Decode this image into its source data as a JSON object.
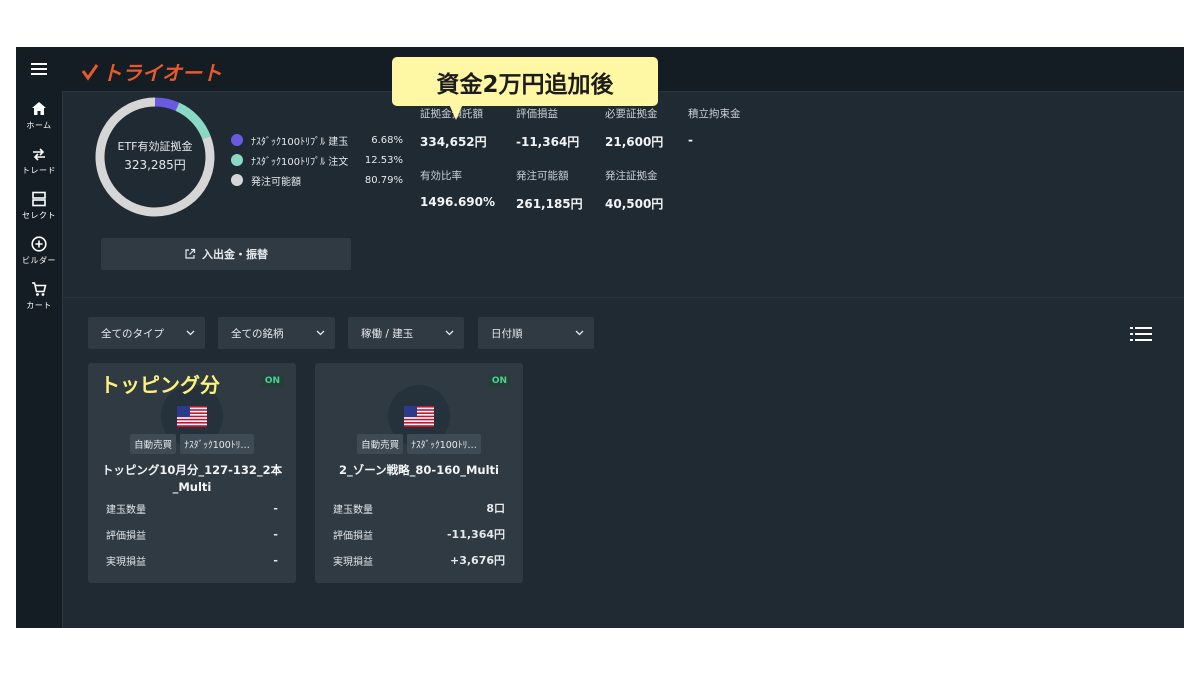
{
  "callout": "資金2万円追加後",
  "logo": "トライオート",
  "nav": [
    {
      "label": "ホーム",
      "icon": "home-icon"
    },
    {
      "label": "トレード",
      "icon": "trade-arrows-icon"
    },
    {
      "label": "セレクト",
      "icon": "select-icon"
    },
    {
      "label": "ビルダー",
      "icon": "builder-plus-icon"
    },
    {
      "label": "カート",
      "icon": "cart-icon"
    }
  ],
  "donut": {
    "label": "ETF有効証拠金",
    "value": "323,285円",
    "segments": [
      {
        "name": "ﾅｽﾀﾞｯｸ100ﾄﾘﾌﾟﾙ 建玉",
        "percent": 6.68,
        "color": "#6a5ae0"
      },
      {
        "name": "ﾅｽﾀﾞｯｸ100ﾄﾘﾌﾟﾙ 注文",
        "percent": 12.53,
        "color": "#8ad8c6"
      },
      {
        "name": "発注可能額",
        "percent": 80.79,
        "color": "#d6d6d6"
      }
    ]
  },
  "legend": [
    {
      "label": "ﾅｽﾀﾞｯｸ100ﾄﾘﾌﾟﾙ 建玉",
      "value": "6.68%"
    },
    {
      "label": "ﾅｽﾀﾞｯｸ100ﾄﾘﾌﾟﾙ 注文",
      "value": "12.53%"
    },
    {
      "label": "発注可能額",
      "value": "80.79%"
    }
  ],
  "stats": {
    "deposit": {
      "label": "証拠金預託額",
      "value": "334,652円"
    },
    "pnl": {
      "label": "評価損益",
      "value": "-11,364円"
    },
    "required": {
      "label": "必要証拠金",
      "value": "21,600円"
    },
    "reserve": {
      "label": "積立拘束金",
      "value": "-"
    },
    "ratio": {
      "label": "有効比率",
      "value": "1496.690%"
    },
    "orderable": {
      "label": "発注可能額",
      "value": "261,185円"
    },
    "order_margin": {
      "label": "発注証拠金",
      "value": "40,500円"
    }
  },
  "transfer_button": "入出金・振替",
  "filters": [
    "全てのタイプ",
    "全ての銘柄",
    "稼働 / 建玉",
    "日付順"
  ],
  "yellow_label": "トッピング分",
  "cards": [
    {
      "status": "ON",
      "tags": [
        "自動売買",
        "ﾅｽﾀﾞｯｸ100ﾄﾘ…"
      ],
      "title": "トッピング10月分_127-132_2本_Multi",
      "rows": [
        {
          "label": "建玉数量",
          "value": "-"
        },
        {
          "label": "評価損益",
          "value": "-"
        },
        {
          "label": "実現損益",
          "value": "-"
        }
      ]
    },
    {
      "status": "ON",
      "tags": [
        "自動売買",
        "ﾅｽﾀﾞｯｸ100ﾄﾘ…"
      ],
      "title": "2_ゾーン戦略_80-160_Multi",
      "rows": [
        {
          "label": "建玉数量",
          "value": "8口"
        },
        {
          "label": "評価損益",
          "value": "-11,364円"
        },
        {
          "label": "実現損益",
          "value": "+3,676円"
        }
      ]
    }
  ]
}
